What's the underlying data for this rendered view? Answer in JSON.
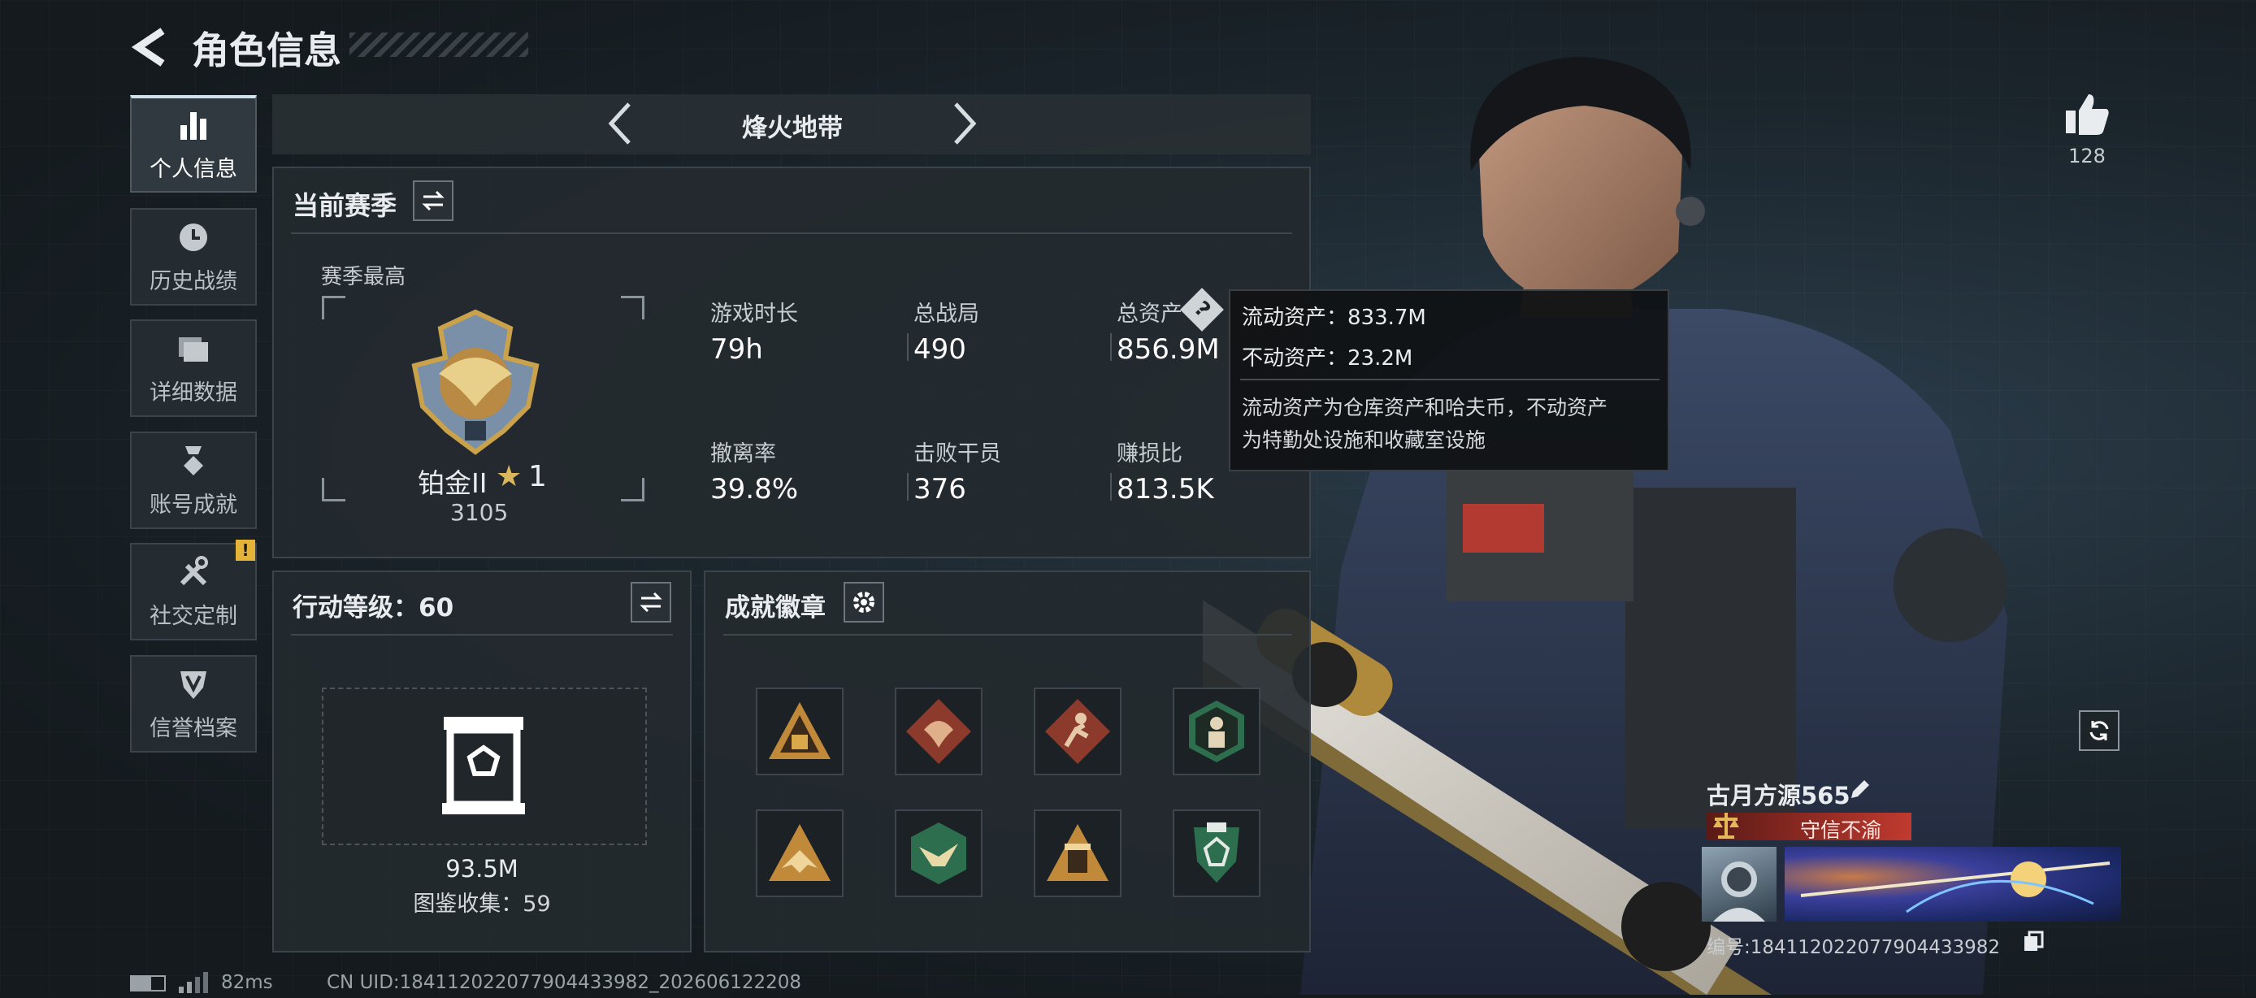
{
  "header": {
    "title": "角色信息"
  },
  "sidebar": {
    "items": [
      {
        "label": "个人信息",
        "icon": "bar-chart-icon"
      },
      {
        "label": "历史战绩",
        "icon": "clock-icon"
      },
      {
        "label": "详细数据",
        "icon": "folder-icon"
      },
      {
        "label": "账号成就",
        "icon": "medal-icon"
      },
      {
        "label": "社交定制",
        "icon": "tools-icon"
      },
      {
        "label": "信誉档案",
        "icon": "shield-icon"
      }
    ],
    "alert_badge": "!"
  },
  "mode_selector": {
    "label": "烽火地带"
  },
  "season": {
    "title": "当前赛季",
    "best_label": "赛季最高",
    "rank": {
      "name": "铂金II",
      "stars": "1",
      "points": "3105"
    },
    "stats": [
      {
        "label": "游戏时长",
        "value": "79h"
      },
      {
        "label": "总战局",
        "value": "490"
      },
      {
        "label": "总资产",
        "value": "856.9M"
      },
      {
        "label": "撤离率",
        "value": "39.8%"
      },
      {
        "label": "击败干员",
        "value": "376"
      },
      {
        "label": "赚损比",
        "value": "813.5K"
      }
    ],
    "help_icon": "?"
  },
  "tooltip": {
    "line1": "流动资产：833.7M",
    "line2": "不动资产：23.2M",
    "desc1": "流动资产为仓库资产和哈夫币，不动资产",
    "desc2": "为特勤处设施和收藏室设施"
  },
  "action_level": {
    "title": "行动等级：60",
    "value": "93.5M",
    "collection": "图鉴收集：59"
  },
  "achievements": {
    "title": "成就徽章",
    "badges": [
      "warning-triangle-badge",
      "dragon-badge",
      "runner-badge",
      "hexagon-figure-badge",
      "wings-triangle-badge",
      "eagle-hexagon-badge",
      "tower-triangle-badge",
      "green-shield-badge"
    ]
  },
  "likes": {
    "count": "128"
  },
  "player": {
    "name": "古月方源565",
    "title": "守信不渝",
    "id": "编号:18411202207790443398​2"
  },
  "footer": {
    "ping": "82ms",
    "uid": "CN UID:18411202207790443398​2_202606122208"
  },
  "colors": {
    "accent": "#c03a2f",
    "panel": "#242a2f",
    "gold": "#c9a24b",
    "badge_red": "#8c3a2c",
    "badge_green": "#2d6e4f"
  }
}
